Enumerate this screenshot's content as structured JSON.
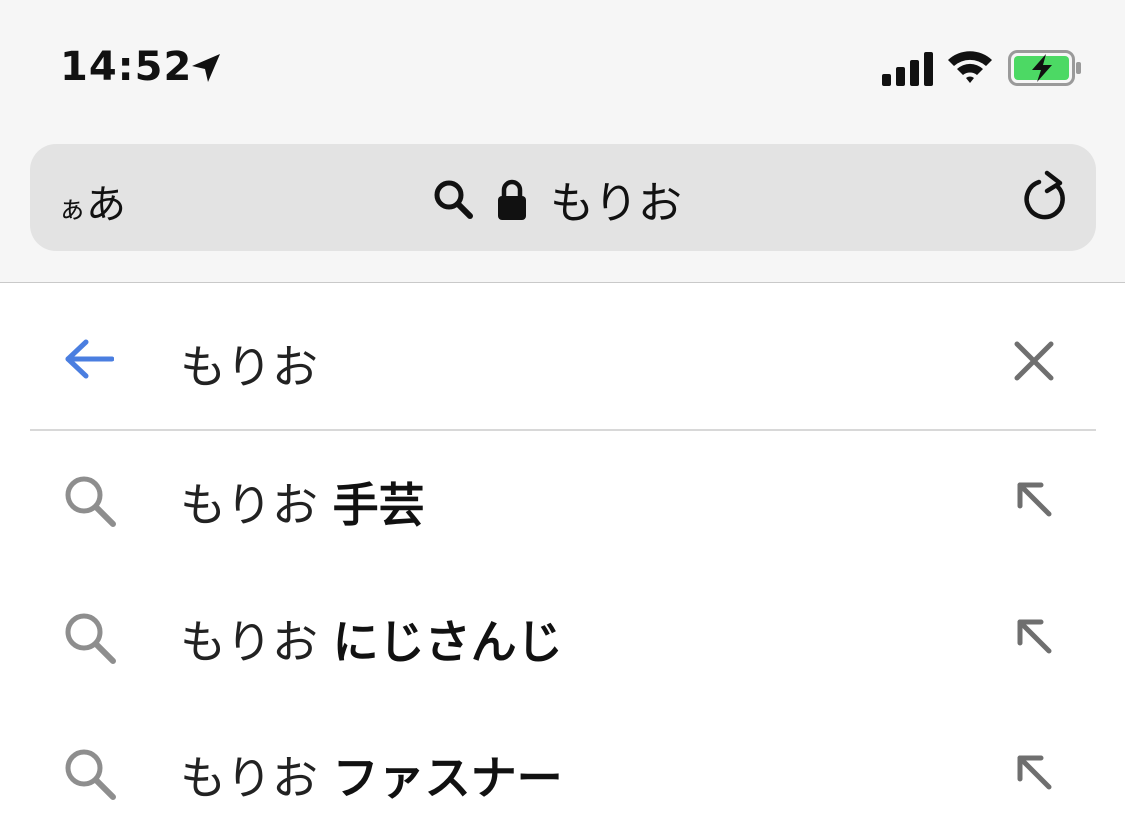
{
  "status_bar": {
    "time": "14:52",
    "icons": [
      "location-arrow-icon",
      "cellular-signal-icon",
      "wifi-icon",
      "battery-charging-icon"
    ],
    "battery_color": "#4cd964"
  },
  "browser_bar": {
    "text_size_label_small": "ぁ",
    "text_size_label_large": "あ",
    "url_text": "もりお",
    "icons": [
      "search-icon",
      "lock-icon",
      "reload-icon"
    ]
  },
  "search": {
    "query": "もりお",
    "accent_color": "#4a7ee0"
  },
  "suggestions": [
    {
      "prefix": "もりお",
      "completion": "手芸"
    },
    {
      "prefix": "もりお",
      "completion": "にじさんじ"
    },
    {
      "prefix": "もりお",
      "completion": "ファスナー"
    }
  ]
}
